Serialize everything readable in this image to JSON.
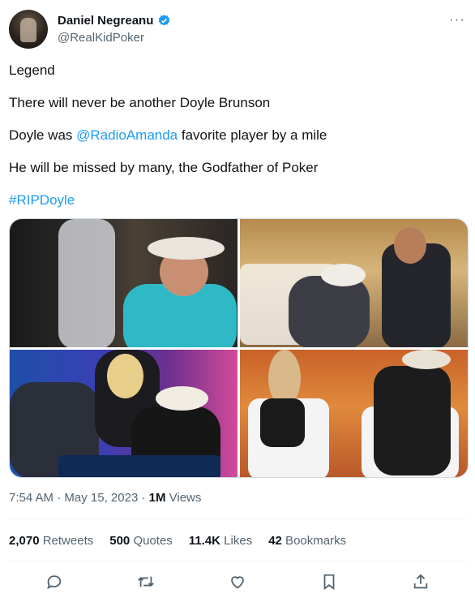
{
  "author": {
    "name": "Daniel Negreanu",
    "handle": "@RealKidPoker",
    "avatar_icon": "avatar-photo",
    "verified_color": "#1d9bf0"
  },
  "tweet": {
    "line1": "Legend",
    "line2": "There will never be another Doyle Brunson",
    "line3_prefix": "Doyle was ",
    "line3_mention": "@RadioAmanda",
    "line3_suffix": " favorite player by a mile",
    "line4": "He will be missed by many, the Godfather of Poker",
    "hashtag": "#RIPDoyle"
  },
  "meta": {
    "time": "7:54 AM",
    "sep1": " · ",
    "date": "May 15, 2023",
    "sep2": " · ",
    "views_count": "1M",
    "views_label": " Views"
  },
  "stats": [
    {
      "count": "2,070",
      "label": " Retweets"
    },
    {
      "count": "500",
      "label": " Quotes"
    },
    {
      "count": "11.4K",
      "label": " Likes"
    },
    {
      "count": "42",
      "label": " Bookmarks"
    }
  ],
  "actions": [
    "reply-icon",
    "retweet-icon",
    "like-icon",
    "bookmark-icon",
    "share-icon"
  ],
  "colors": {
    "link": "#1d9bf0",
    "muted": "#536471",
    "text": "#0f1419"
  }
}
